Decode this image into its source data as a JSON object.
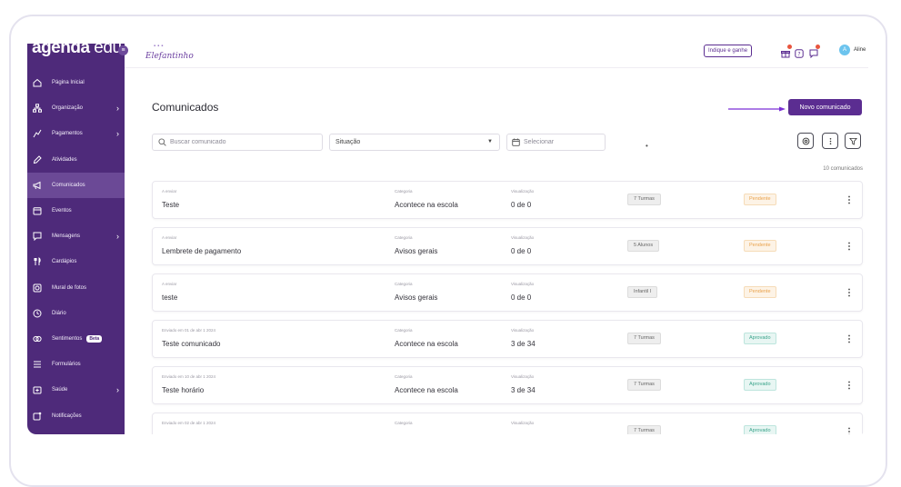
{
  "sidebar": {
    "logo_bold": "agenda",
    "logo_light": " edu",
    "collapse_icon": "menu-icon",
    "items": [
      {
        "label": "Página Inicial",
        "icon": "home-icon",
        "chevron": false,
        "active": false
      },
      {
        "label": "Organização",
        "icon": "org-chart-icon",
        "chevron": true,
        "active": false
      },
      {
        "label": "Pagamentos",
        "icon": "money-icon",
        "chevron": true,
        "active": false
      },
      {
        "label": "Atividades",
        "icon": "pencil-icon",
        "chevron": false,
        "active": false
      },
      {
        "label": "Comunicados",
        "icon": "megaphone-icon",
        "chevron": false,
        "active": true
      },
      {
        "label": "Eventos",
        "icon": "calendar-icon",
        "chevron": false,
        "active": false
      },
      {
        "label": "Mensagens",
        "icon": "chat-icon",
        "chevron": true,
        "active": false
      },
      {
        "label": "Cardápios",
        "icon": "cutlery-icon",
        "chevron": false,
        "active": false
      },
      {
        "label": "Mural de fotos",
        "icon": "photo-icon",
        "chevron": false,
        "active": false
      },
      {
        "label": "Diário",
        "icon": "clock-icon",
        "chevron": false,
        "active": false
      },
      {
        "label": "Sentimentos",
        "icon": "feelings-icon",
        "chevron": false,
        "active": false,
        "badge": "Beta"
      },
      {
        "label": "Formulários",
        "icon": "list-icon",
        "chevron": false,
        "active": false
      },
      {
        "label": "Saúde",
        "icon": "health-icon",
        "chevron": true,
        "active": false
      },
      {
        "label": "Notificações",
        "icon": "notification-icon",
        "chevron": false,
        "active": false
      }
    ]
  },
  "topbar": {
    "school_name": "Elefantinho",
    "indique_label": "Indique e ganhe",
    "avatar_initial": "A",
    "user_name": "Aline"
  },
  "main": {
    "title": "Comunicados",
    "new_button": "Novo comunicado",
    "search_placeholder": "Buscar comunicado",
    "situation_label": "Situação",
    "date_placeholder": "Selecionar",
    "loading_dot": "•",
    "count": "10 comunicados",
    "label_category": "Categoria",
    "label_views": "Visualização",
    "cards": [
      {
        "sent": "A enviar",
        "title": "Teste",
        "category": "Acontece na escola",
        "views": "0 de 0",
        "audience": "7 Turmas",
        "status": "Pendente",
        "status_type": "pending"
      },
      {
        "sent": "A enviar",
        "title": "Lembrete de pagamento",
        "category": "Avisos gerais",
        "views": "0 de 0",
        "audience": "5 Alunos",
        "status": "Pendente",
        "status_type": "pending"
      },
      {
        "sent": "A enviar",
        "title": "teste",
        "category": "Avisos gerais",
        "views": "0 de 0",
        "audience": "Infantil I",
        "status": "Pendente",
        "status_type": "pending"
      },
      {
        "sent": "Enviado em 01 de abr 1 2024",
        "title": "Teste comunicado",
        "category": "Acontece na escola",
        "views": "3 de 34",
        "audience": "7 Turmas",
        "status": "Aprovado",
        "status_type": "approved"
      },
      {
        "sent": "Enviado em 10 de abr 1 2024",
        "title": "Teste horário",
        "category": "Acontece na escola",
        "views": "3 de 34",
        "audience": "7 Turmas",
        "status": "Aprovado",
        "status_type": "approved"
      },
      {
        "sent": "Enviado em 02 de abr 1 2024",
        "title": "",
        "category": "",
        "views": "",
        "audience": "7 Turmas",
        "status": "Aprovado",
        "status_type": "approved"
      }
    ]
  },
  "colors": {
    "sidebar": "#4e2a7a",
    "accent": "#5b2d91",
    "pending": "#e9a24c",
    "approved": "#3aa48b"
  }
}
